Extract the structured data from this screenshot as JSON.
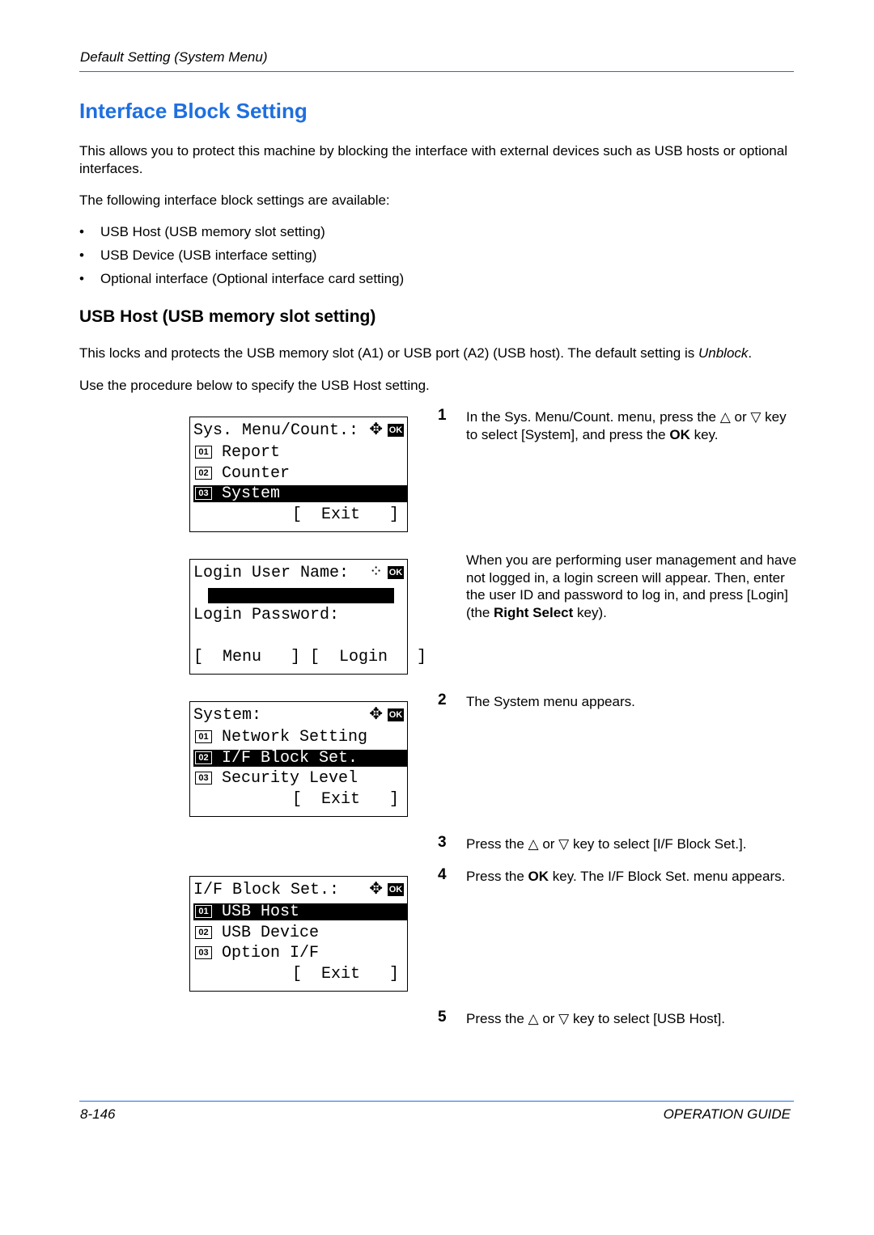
{
  "header": {
    "running_title": "Default Setting (System Menu)",
    "accent_color": "#1e6fe0"
  },
  "title": "Interface Block Setting",
  "intro": [
    "This allows you to protect this machine by blocking the interface with external devices such as USB hosts or optional interfaces.",
    "The following interface block settings are available:"
  ],
  "bullets": [
    "USB Host (USB memory slot setting)",
    "USB Device (USB interface setting)",
    "Optional interface (Optional interface card setting)"
  ],
  "section": {
    "heading": "USB Host (USB memory slot setting)",
    "para1": [
      {
        "t": "This locks and protects the USB memory slot (A1) or USB port (A2) (USB host). The default setting is "
      },
      {
        "t": "Unblock",
        "i": true
      },
      {
        "t": "."
      }
    ],
    "para2": "Use the procedure below to specify the USB Host setting."
  },
  "lcd_screens": [
    {
      "title": "Sys. Menu/Count.:",
      "icon": "arrows-ok",
      "items": [
        {
          "n": "01",
          "label": "Report"
        },
        {
          "n": "02",
          "label": "Counter"
        },
        {
          "n": "03",
          "label": "System",
          "selected": true
        }
      ],
      "softkeys": "[  Exit   ]"
    },
    {
      "title": "Login User Name:",
      "icon": "arrows-ok-dotted",
      "field2": "Login Password:",
      "softkeys": "[  Menu   ] [  Login   ]"
    },
    {
      "title": "System:",
      "icon": "arrows-ok",
      "items": [
        {
          "n": "01",
          "label": "Network Setting"
        },
        {
          "n": "02",
          "label": "I/F Block Set.",
          "selected": true
        },
        {
          "n": "03",
          "label": "Security Level"
        }
      ],
      "softkeys": "[  Exit   ]"
    },
    {
      "title": "I/F Block Set.:",
      "icon": "arrows-ok",
      "items": [
        {
          "n": "01",
          "label": "USB Host",
          "selected": true
        },
        {
          "n": "02",
          "label": "USB Device"
        },
        {
          "n": "03",
          "label": "Option I/F"
        }
      ],
      "softkeys": "[  Exit   ]"
    }
  ],
  "ok_label": "OK",
  "steps": [
    {
      "num": "1",
      "text": [
        {
          "t": "In the Sys. Menu/Count. menu, press the △ or ▽ key to select [System], and press the "
        },
        {
          "t": "OK",
          "b": true
        },
        {
          "t": " key."
        }
      ]
    },
    {
      "num": "",
      "text": [
        {
          "t": "When you are performing user management and have not logged in, a login screen will appear. Then, enter the user ID and password to log in, and press [Login] (the "
        },
        {
          "t": "Right Select",
          "b": true
        },
        {
          "t": " key)."
        }
      ]
    },
    {
      "num": "2",
      "text": [
        {
          "t": "The System menu appears."
        }
      ]
    },
    {
      "num": "3",
      "text": [
        {
          "t": "Press the △ or ▽ key to select [I/F Block Set.]."
        }
      ]
    },
    {
      "num": "4",
      "text": [
        {
          "t": "Press the "
        },
        {
          "t": "OK",
          "b": true
        },
        {
          "t": " key. The I/F Block Set. menu appears."
        }
      ]
    },
    {
      "num": "5",
      "text": [
        {
          "t": "Press the △ or ▽ key to select [USB Host]."
        }
      ]
    }
  ],
  "footer": {
    "page": "8-146",
    "guide": "OPERATION GUIDE"
  }
}
